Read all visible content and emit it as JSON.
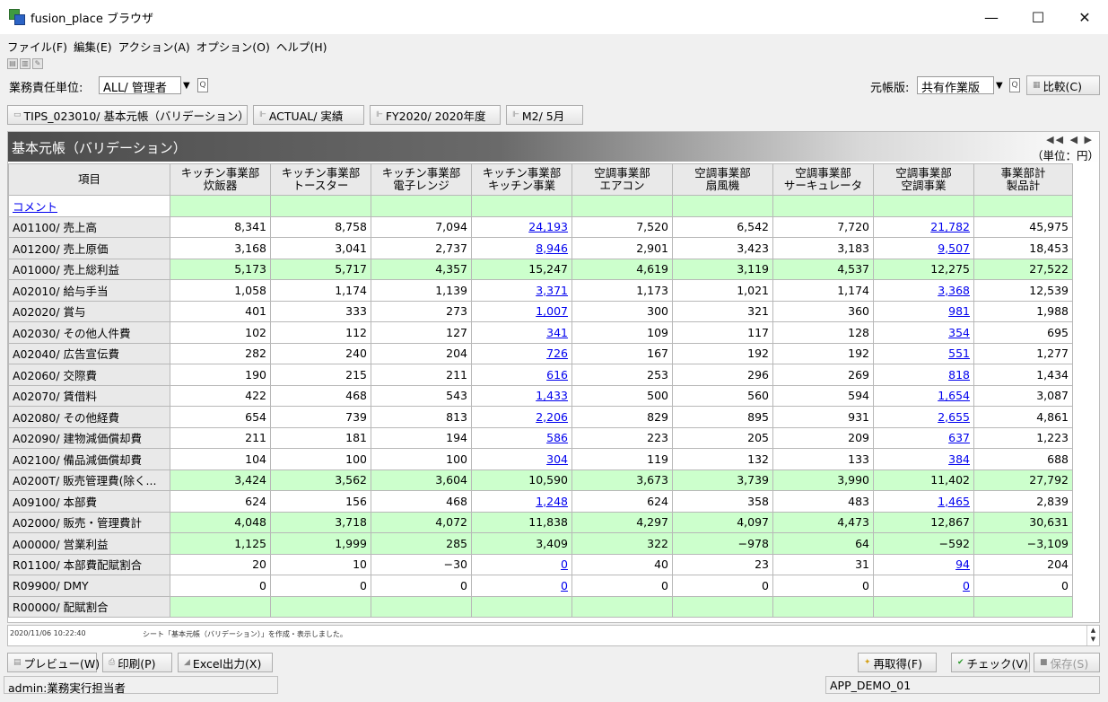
{
  "window": {
    "title": "fusion_place ブラウザ",
    "minimize": "—",
    "maximize": "☐",
    "close": "✕"
  },
  "menu": [
    "ファイル(F)",
    "編集(E)",
    "アクション(A)",
    "オプション(O)",
    "ヘルプ(H)"
  ],
  "filter": {
    "unit_label": "業務責任単位:",
    "unit_value": "ALL/ 管理者",
    "ledger_label": "元帳版:",
    "ledger_value": "共有作業版",
    "compare_button": "比較(C)"
  },
  "tabs": [
    {
      "icon": "table-icon",
      "label": "TIPS_023010/ 基本元帳（バリデーション）"
    },
    {
      "icon": "dimension-icon",
      "label": "ACTUAL/ 実績"
    },
    {
      "icon": "dimension-icon",
      "label": "FY2020/ 2020年度"
    },
    {
      "icon": "dimension-icon",
      "label": "M2/ 5月"
    }
  ],
  "sheet": {
    "title": "基本元帳（バリデーション）",
    "unit": "（単位：円）",
    "nav": "◀◀ ◀ ▶",
    "columns": [
      [
        "項目",
        ""
      ],
      [
        "キッチン事業部",
        "炊飯器"
      ],
      [
        "キッチン事業部",
        "トースター"
      ],
      [
        "キッチン事業部",
        "電子レンジ"
      ],
      [
        "キッチン事業部",
        "キッチン事業"
      ],
      [
        "空調事業部",
        "エアコン"
      ],
      [
        "空調事業部",
        "扇風機"
      ],
      [
        "空調事業部",
        "サーキュレータ"
      ],
      [
        "空調事業部",
        "空調事業"
      ],
      [
        "事業部計",
        "製品計"
      ]
    ],
    "rows": [
      {
        "label": "コメント",
        "values": [
          "",
          "",
          "",
          "",
          "",
          "",
          "",
          "",
          ""
        ],
        "green": true,
        "comment": true
      },
      {
        "label": "A01100/ 売上高",
        "values": [
          "8,341",
          "8,758",
          "7,094",
          "24,193",
          "7,520",
          "6,542",
          "7,720",
          "21,782",
          "45,975"
        ],
        "green": false
      },
      {
        "label": "A01200/ 売上原価",
        "values": [
          "3,168",
          "3,041",
          "2,737",
          "8,946",
          "2,901",
          "3,423",
          "3,183",
          "9,507",
          "18,453"
        ],
        "green": false
      },
      {
        "label": "A01000/ 売上総利益",
        "values": [
          "5,173",
          "5,717",
          "4,357",
          "15,247",
          "4,619",
          "3,119",
          "4,537",
          "12,275",
          "27,522"
        ],
        "green": true
      },
      {
        "label": "A02010/ 給与手当",
        "values": [
          "1,058",
          "1,174",
          "1,139",
          "3,371",
          "1,173",
          "1,021",
          "1,174",
          "3,368",
          "12,539"
        ],
        "green": false
      },
      {
        "label": "A02020/ 賞与",
        "values": [
          "401",
          "333",
          "273",
          "1,007",
          "300",
          "321",
          "360",
          "981",
          "1,988"
        ],
        "green": false
      },
      {
        "label": "A02030/ その他人件費",
        "values": [
          "102",
          "112",
          "127",
          "341",
          "109",
          "117",
          "128",
          "354",
          "695"
        ],
        "green": false
      },
      {
        "label": "A02040/ 広告宣伝費",
        "values": [
          "282",
          "240",
          "204",
          "726",
          "167",
          "192",
          "192",
          "551",
          "1,277"
        ],
        "green": false
      },
      {
        "label": "A02060/ 交際費",
        "values": [
          "190",
          "215",
          "211",
          "616",
          "253",
          "296",
          "269",
          "818",
          "1,434"
        ],
        "green": false
      },
      {
        "label": "A02070/ 賃借料",
        "values": [
          "422",
          "468",
          "543",
          "1,433",
          "500",
          "560",
          "594",
          "1,654",
          "3,087"
        ],
        "green": false
      },
      {
        "label": "A02080/ その他経費",
        "values": [
          "654",
          "739",
          "813",
          "2,206",
          "829",
          "895",
          "931",
          "2,655",
          "4,861"
        ],
        "green": false
      },
      {
        "label": "A02090/ 建物減価償却費",
        "values": [
          "211",
          "181",
          "194",
          "586",
          "223",
          "205",
          "209",
          "637",
          "1,223"
        ],
        "green": false
      },
      {
        "label": "A02100/ 備品減価償却費",
        "values": [
          "104",
          "100",
          "100",
          "304",
          "119",
          "132",
          "133",
          "384",
          "688"
        ],
        "green": false
      },
      {
        "label": "A0200T/ 販売管理費(除く...",
        "values": [
          "3,424",
          "3,562",
          "3,604",
          "10,590",
          "3,673",
          "3,739",
          "3,990",
          "11,402",
          "27,792"
        ],
        "green": true
      },
      {
        "label": "A09100/ 本部費",
        "values": [
          "624",
          "156",
          "468",
          "1,248",
          "624",
          "358",
          "483",
          "1,465",
          "2,839"
        ],
        "green": false
      },
      {
        "label": "A02000/ 販売・管理費計",
        "values": [
          "4,048",
          "3,718",
          "4,072",
          "11,838",
          "4,297",
          "4,097",
          "4,473",
          "12,867",
          "30,631"
        ],
        "green": true
      },
      {
        "label": "A00000/ 営業利益",
        "values": [
          "1,125",
          "1,999",
          "285",
          "3,409",
          "322",
          "−978",
          "64",
          "−592",
          "−3,109"
        ],
        "green": true
      },
      {
        "label": "R01100/ 本部費配賦割合",
        "values": [
          "20",
          "10",
          "−30",
          "0",
          "40",
          "23",
          "31",
          "94",
          "204"
        ],
        "green": false
      },
      {
        "label": "R09900/ DMY",
        "values": [
          "0",
          "0",
          "0",
          "0",
          "0",
          "0",
          "0",
          "0",
          "0"
        ],
        "green": false
      },
      {
        "label": "R00000/ 配賦割合",
        "values": [
          "",
          "",
          "",
          "",
          "",
          "",
          "",
          "",
          ""
        ],
        "green": true
      }
    ]
  },
  "log": {
    "time": "2020/11/06 10:22:40",
    "message": "シート「基本元帳（バリデーション）」を作成・表示しました。"
  },
  "bottom_buttons": {
    "preview": "プレビュー(W)",
    "print": "印刷(P)",
    "excel": "Excel出力(X)",
    "refetch": "再取得(F)",
    "check": "チェック(V)",
    "save": "保存(S)"
  },
  "status": {
    "user": "admin:業務実行担当者",
    "app": "APP_DEMO_01"
  }
}
